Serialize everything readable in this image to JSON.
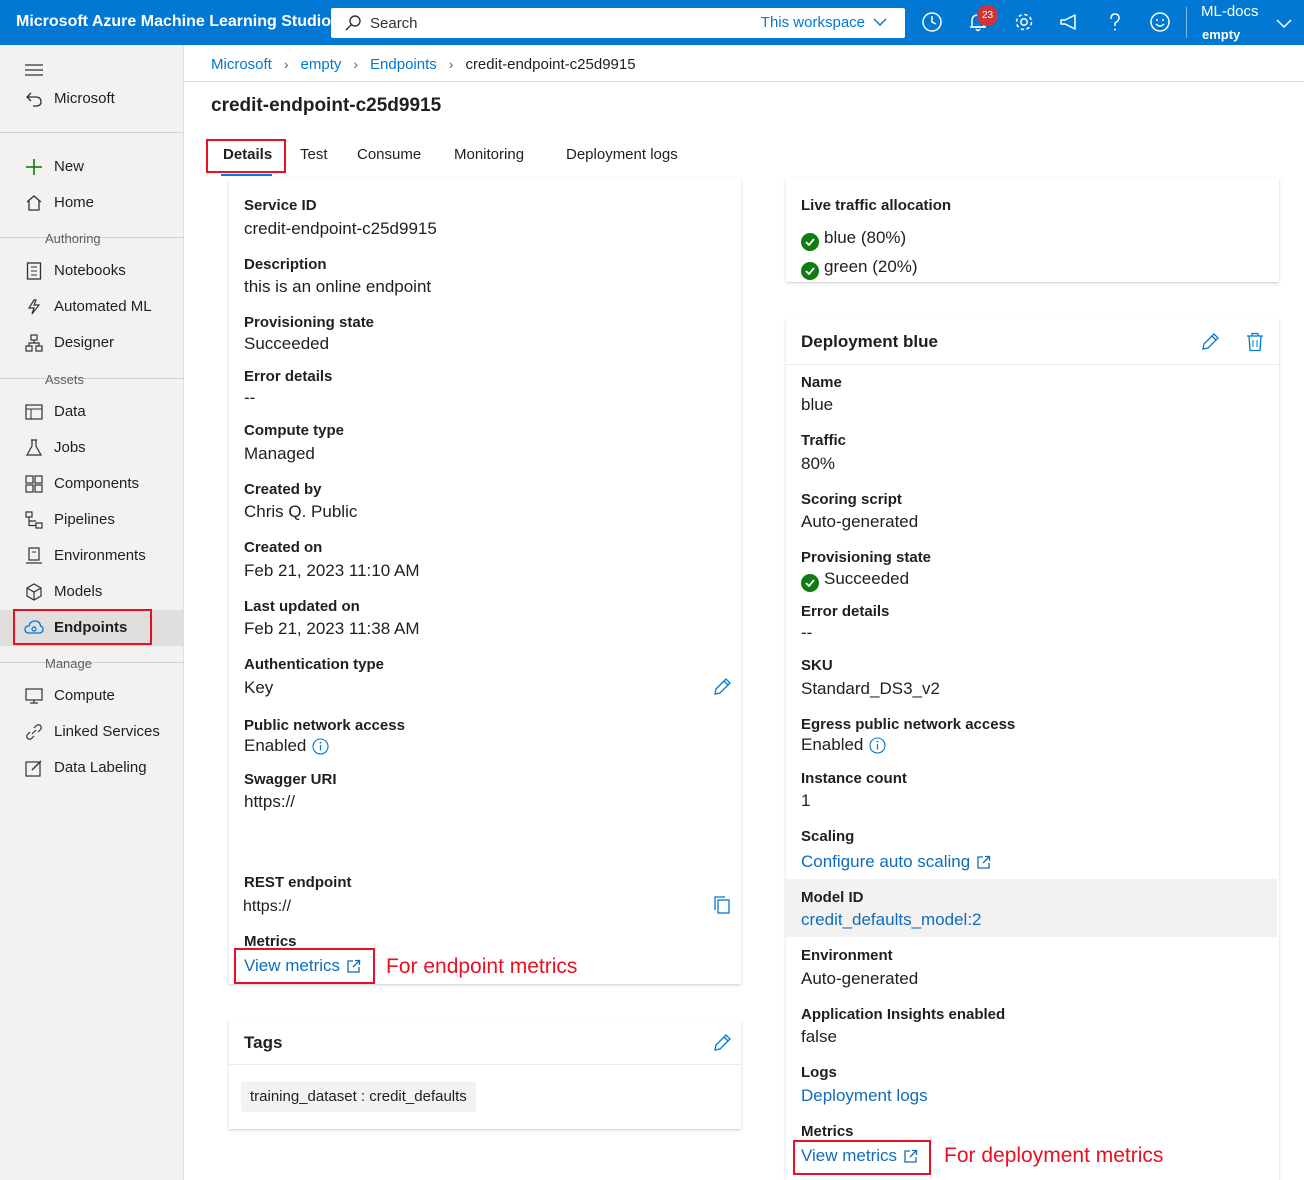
{
  "topbar": {
    "app_title": "Microsoft Azure Machine Learning Studio",
    "search_placeholder": "Search",
    "search_scope": "This workspace",
    "notification_count": "23",
    "workspace_name": "ML-docs",
    "workspace_sub": "empty"
  },
  "sidebar": {
    "back_label": "Microsoft",
    "new_label": "New",
    "home_label": "Home",
    "section_authoring": "Authoring",
    "notebooks": "Notebooks",
    "automated_ml": "Automated ML",
    "designer": "Designer",
    "section_assets": "Assets",
    "data": "Data",
    "jobs": "Jobs",
    "components": "Components",
    "pipelines": "Pipelines",
    "environments": "Environments",
    "models": "Models",
    "endpoints": "Endpoints",
    "section_manage": "Manage",
    "compute": "Compute",
    "linked_services": "Linked Services",
    "data_labeling": "Data Labeling"
  },
  "breadcrumb": [
    "Microsoft",
    "empty",
    "Endpoints",
    "credit-endpoint-c25d9915"
  ],
  "page_title": "credit-endpoint-c25d9915",
  "tabs": [
    "Details",
    "Test",
    "Consume",
    "Monitoring",
    "Deployment logs"
  ],
  "details": {
    "service_id_label": "Service ID",
    "service_id": "credit-endpoint-c25d9915",
    "description_label": "Description",
    "description": "this is an online endpoint",
    "provisioning_label": "Provisioning state",
    "provisioning": "Succeeded",
    "error_label": "Error details",
    "error": "--",
    "compute_type_label": "Compute type",
    "compute_type": "Managed",
    "created_by_label": "Created by",
    "created_by": "Chris Q. Public",
    "created_on_label": "Created on",
    "created_on": "Feb 21, 2023 11:10 AM",
    "updated_label": "Last updated on",
    "updated": "Feb 21, 2023 11:38 AM",
    "auth_label": "Authentication type",
    "auth": "Key",
    "public_access_label": "Public network access",
    "public_access": "Enabled",
    "swagger_label": "Swagger URI",
    "swagger": "https://",
    "rest_label": "REST endpoint",
    "rest": "https://",
    "metrics_label": "Metrics",
    "metrics_link": "View metrics"
  },
  "annotations": {
    "endpoint": "For endpoint metrics",
    "deployment": "For deployment metrics"
  },
  "tags": {
    "title": "Tags",
    "items": [
      "training_dataset : credit_defaults"
    ]
  },
  "traffic": {
    "label": "Live traffic allocation",
    "items": [
      "blue (80%)",
      "green (20%)"
    ]
  },
  "deployment": {
    "title": "Deployment blue",
    "name_label": "Name",
    "name": "blue",
    "traffic_label": "Traffic",
    "traffic": "80%",
    "scoring_label": "Scoring script",
    "scoring": "Auto-generated",
    "provisioning_label": "Provisioning state",
    "provisioning": "Succeeded",
    "error_label": "Error details",
    "error": "--",
    "sku_label": "SKU",
    "sku": "Standard_DS3_v2",
    "egress_label": "Egress public network access",
    "egress": "Enabled",
    "instance_label": "Instance count",
    "instance": "1",
    "scaling_label": "Scaling",
    "scaling_link": "Configure auto scaling",
    "model_label": "Model ID",
    "model_link": "credit_defaults_model:2",
    "env_label": "Environment",
    "env": "Auto-generated",
    "insights_label": "Application Insights enabled",
    "insights": "false",
    "logs_label": "Logs",
    "logs_link": "Deployment logs",
    "metrics_label": "Metrics",
    "metrics_link": "View metrics"
  },
  "colors": {
    "brand": "#0078d4",
    "link": "#0f6cbd",
    "annotation": "#e81123",
    "success": "#107c10"
  }
}
